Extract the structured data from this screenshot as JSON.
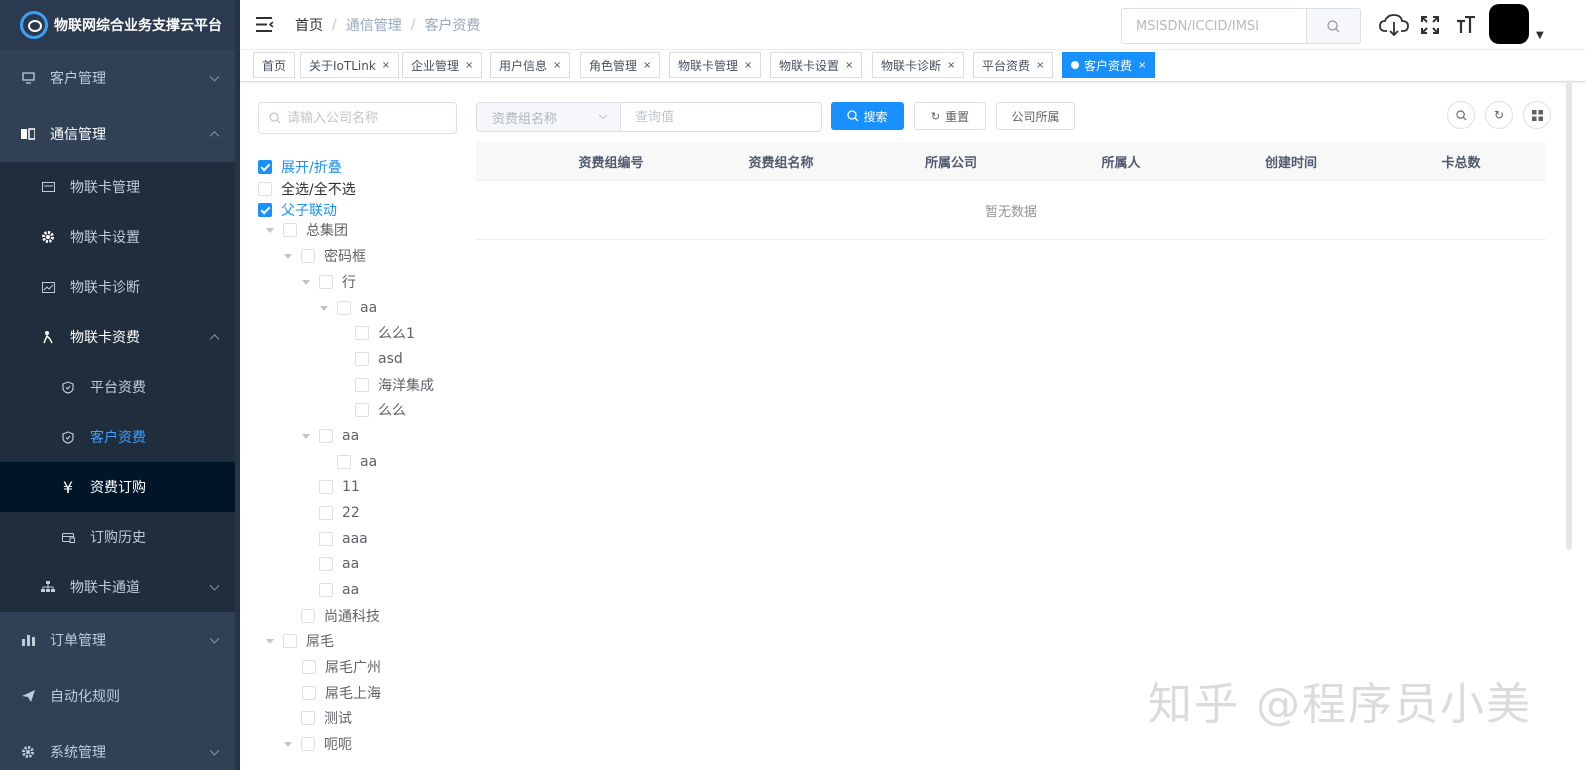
{
  "app": {
    "title": "物联网综合业务支撑云平台"
  },
  "sidebar": {
    "items": [
      {
        "label": "客户管理",
        "icon": "monitor-icon"
      },
      {
        "label": "通信管理",
        "icon": "book-icon"
      },
      {
        "label": "物联卡管理",
        "icon": "card-icon"
      },
      {
        "label": "物联卡设置",
        "icon": "gear-icon"
      },
      {
        "label": "物联卡诊断",
        "icon": "chart-icon"
      },
      {
        "label": "物联卡资费",
        "icon": "person-icon"
      },
      {
        "label": "平台资费",
        "icon": "shield-icon"
      },
      {
        "label": "客户资费",
        "icon": "shield-icon"
      },
      {
        "label": "资费订购",
        "icon": "yen-icon"
      },
      {
        "label": "订购历史",
        "icon": "card-list-icon"
      },
      {
        "label": "物联卡通道",
        "icon": "tree-icon"
      },
      {
        "label": "订单管理",
        "icon": "bar-chart-icon"
      },
      {
        "label": "自动化规则",
        "icon": "send-icon"
      },
      {
        "label": "系统管理",
        "icon": "gear-icon"
      }
    ]
  },
  "navbar": {
    "breadcrumb": [
      "首页",
      "通信管理",
      "客户资费"
    ],
    "breadcrumb_sep": "/",
    "search_placeholder": "MSISDN/ICCID/IMSI"
  },
  "tags": [
    {
      "label": "首页",
      "closable": false
    },
    {
      "label": "关于IoTLink",
      "closable": true
    },
    {
      "label": "企业管理",
      "closable": true
    },
    {
      "label": "用户信息",
      "closable": true
    },
    {
      "label": "角色管理",
      "closable": true
    },
    {
      "label": "物联卡管理",
      "closable": true
    },
    {
      "label": "物联卡设置",
      "closable": true
    },
    {
      "label": "物联卡诊断",
      "closable": true
    },
    {
      "label": "平台资费",
      "closable": true
    },
    {
      "label": "客户资费",
      "closable": true,
      "active": true
    }
  ],
  "tag_close": "×",
  "tree": {
    "search_placeholder": "请输入公司名称",
    "options": [
      {
        "label": "展开/折叠",
        "checked": true
      },
      {
        "label": "全选/全不选",
        "checked": false
      },
      {
        "label": "父子联动",
        "checked": true
      }
    ],
    "nodes": [
      {
        "label": "总集团",
        "expanded": true
      },
      {
        "label": "密码框",
        "expanded": true
      },
      {
        "label": "行",
        "expanded": true
      },
      {
        "label": "aa",
        "expanded": true
      },
      {
        "label": "么么1"
      },
      {
        "label": "asd"
      },
      {
        "label": "海洋集成"
      },
      {
        "label": "么么"
      },
      {
        "label": "aa",
        "expanded": true
      },
      {
        "label": "aa"
      },
      {
        "label": "11"
      },
      {
        "label": "22"
      },
      {
        "label": "aaa"
      },
      {
        "label": "aa"
      },
      {
        "label": "aa"
      },
      {
        "label": "尚通科技"
      },
      {
        "label": "屌毛",
        "expanded": true
      },
      {
        "label": "屌毛广州"
      },
      {
        "label": "屌毛上海"
      },
      {
        "label": "测试"
      },
      {
        "label": "呃呃",
        "expanded": true
      }
    ]
  },
  "filters": {
    "select_value": "资费组名称",
    "query_placeholder": "查询值",
    "search_label": "搜索",
    "reset_label": "重置",
    "company_label": "公司所属"
  },
  "table": {
    "columns": [
      "资费组编号",
      "资费组名称",
      "所属公司",
      "所属人",
      "创建时间",
      "卡总数"
    ],
    "rows": [],
    "empty_text": "暂无数据"
  },
  "watermark": "知乎 @程序员小美",
  "colors": {
    "primary": "#1890ff",
    "sidebar_bg": "#304156",
    "submenu_bg": "#1f2d3d",
    "active_text": "#409eff"
  }
}
